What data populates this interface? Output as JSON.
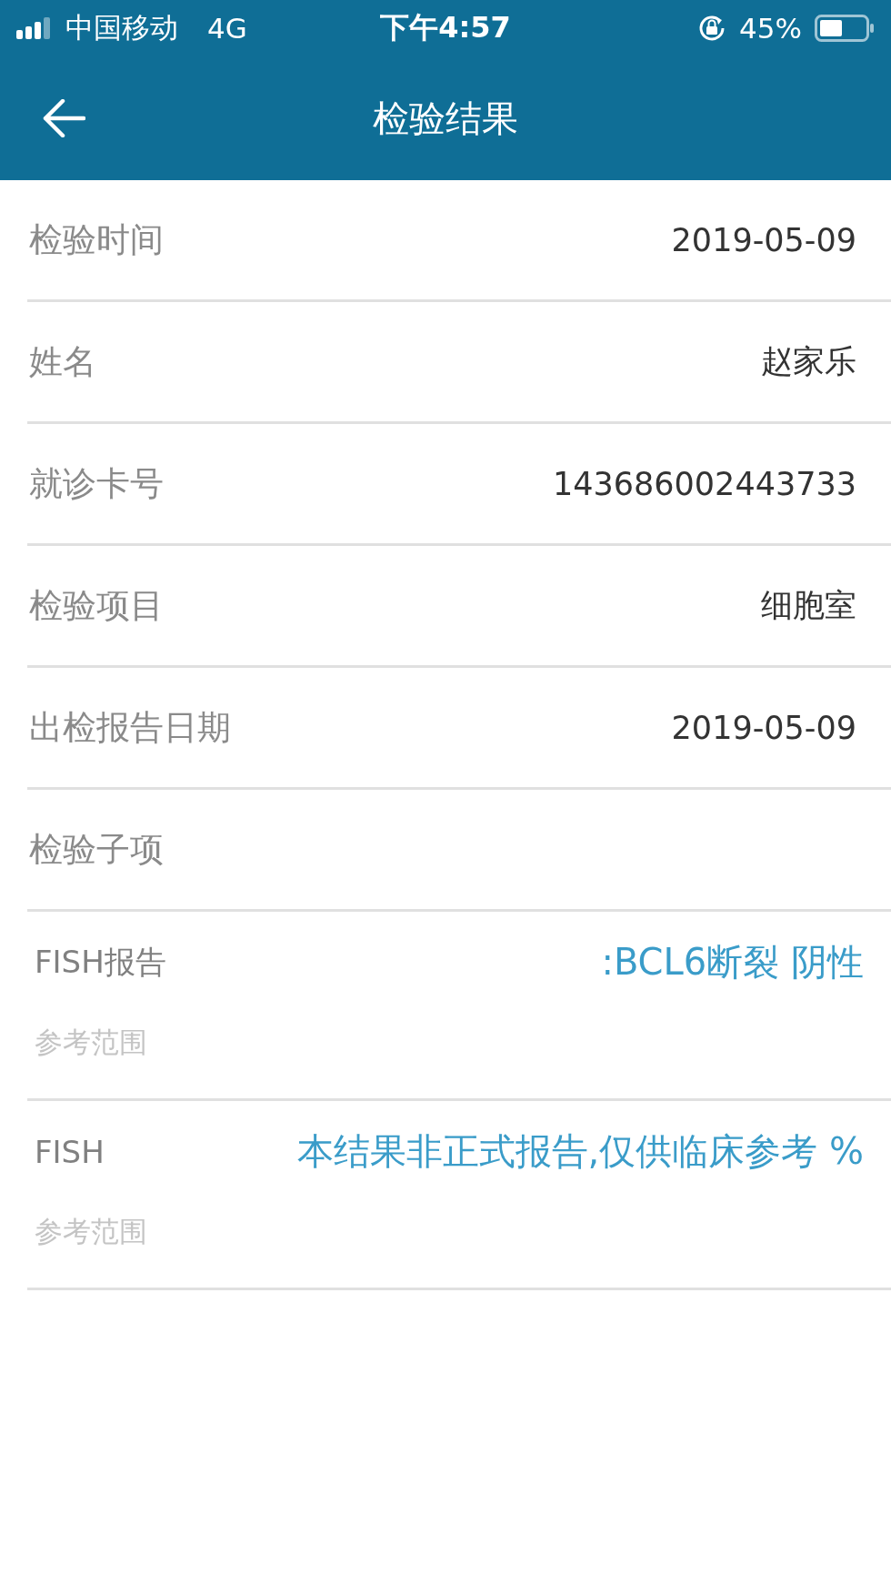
{
  "status_bar": {
    "carrier": "中国移动",
    "network": "4G",
    "time": "下午4:57",
    "battery_percent": "45%"
  },
  "nav": {
    "title": "检验结果"
  },
  "fields": [
    {
      "label": "检验时间",
      "value": "2019-05-09"
    },
    {
      "label": "姓名",
      "value": "赵家乐"
    },
    {
      "label": "就诊卡号",
      "value": "143686002443733"
    },
    {
      "label": "检验项目",
      "value": "细胞室"
    },
    {
      "label": "出检报告日期",
      "value": "2019-05-09"
    }
  ],
  "section": {
    "label": "检验子项"
  },
  "sub_items": [
    {
      "name": "FISH报告",
      "result": ":BCL6断裂 阴性",
      "range_label": "参考范围"
    },
    {
      "name": "FISH",
      "result": "本结果非正式报告,仅供临床参考 %",
      "range_label": "参考范围"
    }
  ]
}
